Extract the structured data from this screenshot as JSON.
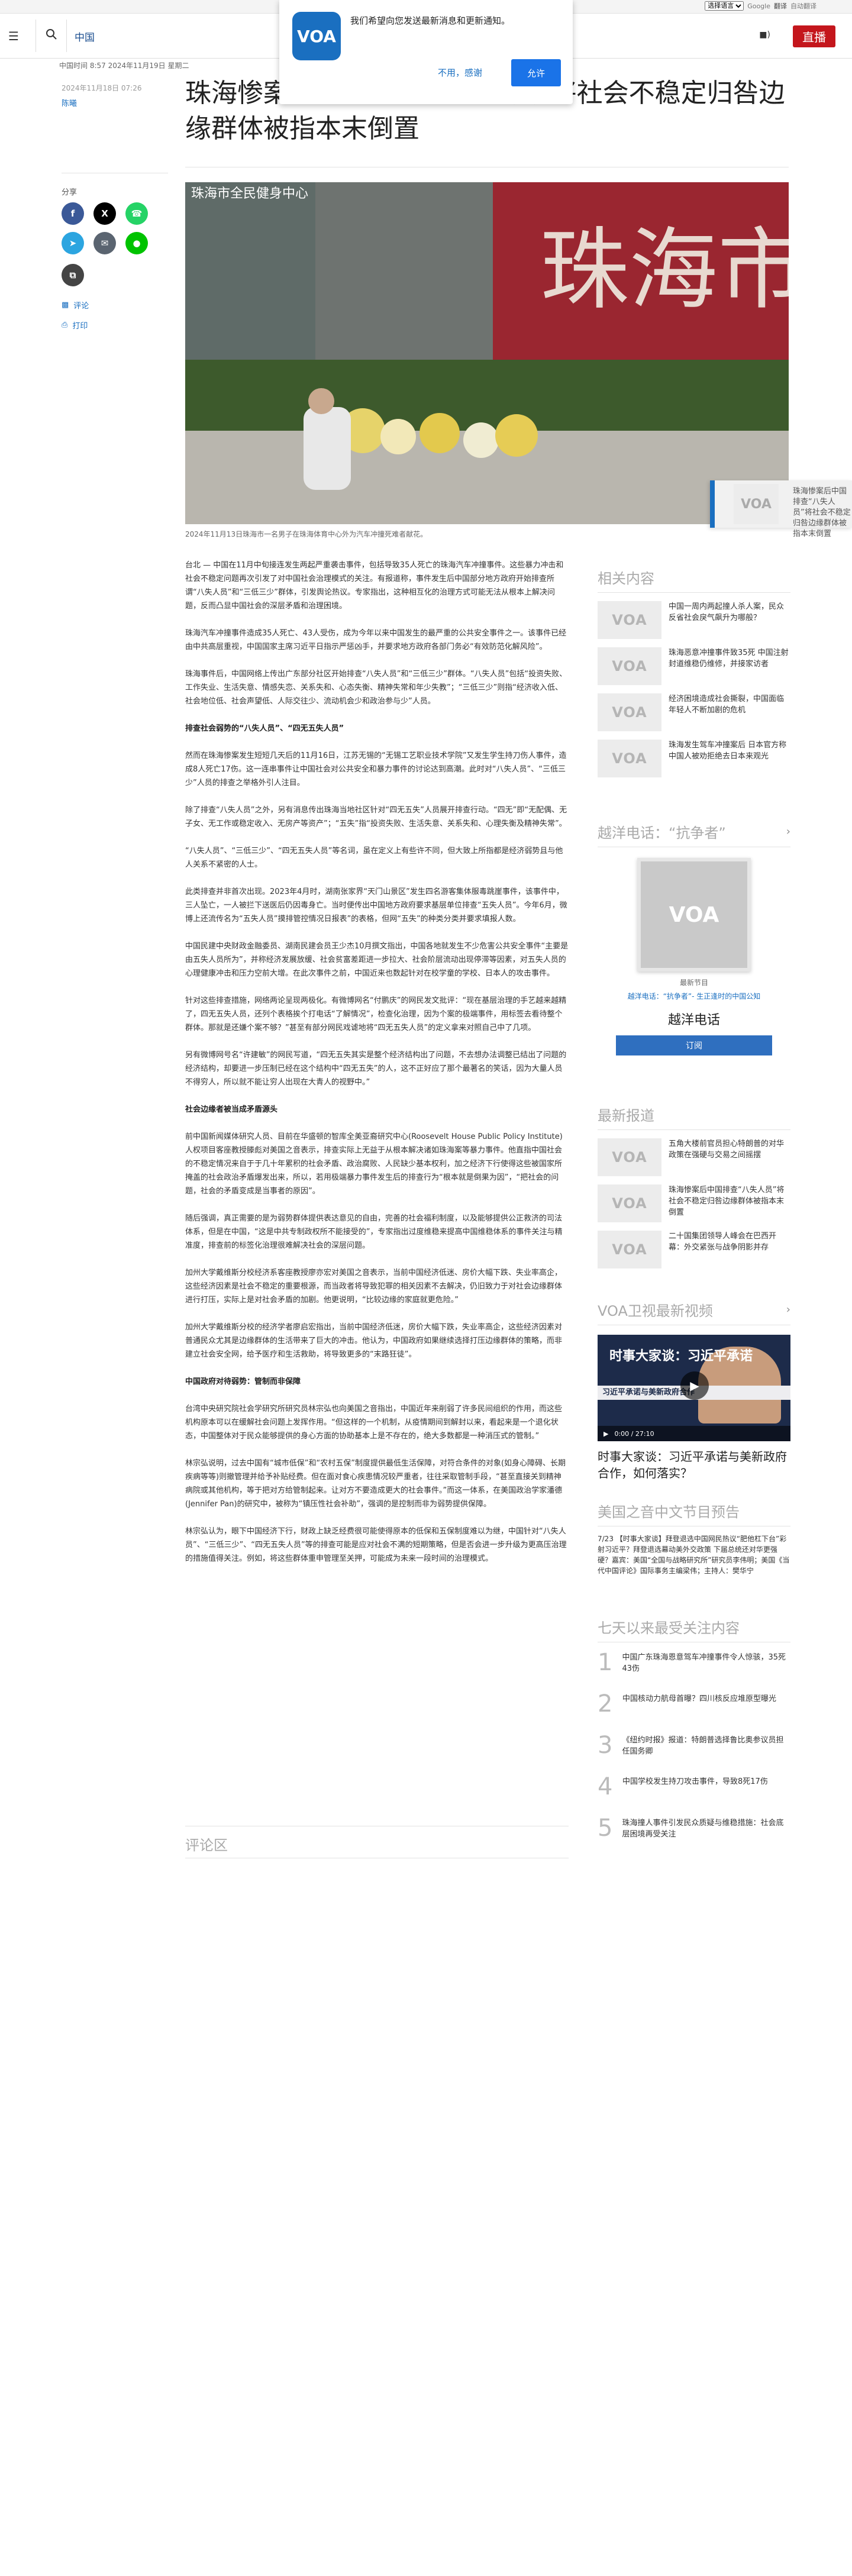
{
  "topbar": {
    "language_select": "选择语言",
    "gt_label": "Google",
    "translate_label": "翻译",
    "translate_suffix": "自动翻译"
  },
  "nav": {
    "section": "中国",
    "live_label": "直播"
  },
  "popup": {
    "logo": "VOA",
    "message": "我们希望向您发送最新消息和更新通知。",
    "decline": "不用，感谢",
    "accept": "允许"
  },
  "article": {
    "datetime": "中国时间 8:57 2024年11月19日 星期二",
    "pubdate": "2024年11月18日 07:26",
    "author": "陈曦",
    "title": "珠海惨案后中国指控“八失人员”将社会不稳定归咎边缘群体被指本末倒置",
    "share_label": "分享",
    "comment_link": "评论",
    "print_link": "打印",
    "caption": "2024年11月13日珠海市一名男子在珠海体育中心外为汽车冲撞死难者献花。",
    "paragraphs": [
      "台北 — 中国在11月中旬接连发生两起严重袭击事件，包括导致35人死亡的珠海汽车冲撞事件。这些暴力冲击和社会不稳定问题再次引发了对中国社会治理模式的关注。有报道称，事件发生后中国部分地方政府开始排查所谓“八失人员”和“三低三少”群体，引发舆论热议。专家指出，这种相互化的治理方式可能无法从根本上解决问题，反而凸显中国社会的深层矛盾和治理困境。",
      "珠海汽车冲撞事件造成35人死亡、43人受伤，成为今年以来中国发生的最严重的公共安全事件之一。该事件已经由中共高层重视，中国国家主席习近平日指示严惩凶手，并要求地方政府各部门务必“有效防范化解风险”。",
      "珠海事件后，中国网络上传出广东部分社区开始排查“八失人员”和“三低三少”群体。“八失人员”包括“投资失败、工作失业、生活失意、情感失恋、关系失和、心态失衡、精神失常和年少失教”；“三低三少”则指“经济收入低、社会地位低、社会声望低、人际交往少、流动机会少和政治参与少”人员。"
    ],
    "h1": "排查社会弱势的“八失人员”、“四无五失人员”",
    "paragraphs2": [
      "然而在珠海惨案发生短短几天后的11月16日，江苏无锡的“无锡工艺职业技术学院”又发生学生持刀伤人事件，造成8人死亡17伤。这一连串事件让中国社会对公共安全和暴力事件的讨论达到高潮。此时对“八失人员”、“三低三少”人员的排查之举格外引人注目。",
      "除了排查“八失人员”之外，另有消息传出珠海当地社区针对“四无五失”人员展开排查行动。“四无”即“无配偶、无子女、无工作或稳定收入、无房产等资产”；“五失”指“投资失败、生活失意、关系失和、心理失衡及精神失常”。",
      "“八失人员”、“三低三少”、“四无五失人员”等名词，虽在定义上有些许不同，但大致上所指都是经济弱势且与他人关系不紧密的人士。",
      "此类排查并非首次出现。2023年4月时，湖南张家界“天门山景区”发生四名游客集体服毒跳崖事件，该事件中，三人坠亡，一人被拦下送医后仍因毒身亡。当时便传出中国地方政府要求基层单位排查“五失人员”。今年6月，微博上还流传名为“五失人员”摸排管控情况日报表”的表格，但网“五失”的种类分类并要求填报人数。",
      "中国民建中央财政金融委员、湖南民建会员王少杰10月撰文指出，中国各地就发生不少危害公共安全事件“主要是由五失人员所为”，并称经济发展放缓、社会贫富差距进一步拉大、社会阶层流动出现停滞等因素，对五失人员的心理健康冲击和压力空前大增。在此次事件之前，中国近来也数起针对在校学童的学校、日本人的攻击事件。",
      "针对这些排查措施，网络两论呈现两极化。有微博网名“付鹏庆”的网民发文批评：“现在基层治理的手艺越来越精了，四无五失人员，还列个表格挨个打电话“了解情况”，检查化治理，因为个案的极端事件，用标签去看待整个群体。那就是还嫌个案不够？”甚至有部分网民戏谑地将“四无五失人员”的定义拿来对照自己中了几项。",
      "另有微博网号名“许建敏”的网民写道，“四无五失其实是整个经济结构出了问题，不去想办法调整已结出了问题的经济结构，却要进一步压制已经在这个结构中“四无五失”的人，这不正好应了那个最著名的笑话，因为大量人员不得穷人，所以就不能让穷人出现在大青人的视野中。”"
    ],
    "h2": "社会边缘者被当成矛盾源头",
    "paragraphs3": [
      "前中国新闻媒体研究人员、目前在华盛顿的智库全美亚裔研究中心(Roosevelt House Public Policy Institute)人权项目客座教授滕彪对美国之音表示，排查实际上无益于从根本解决诸如珠海案等暴力事件。他直指中国社会的不稳定情况来自于于几十年累积的社会矛盾、政治腐败、人民缺少基本权利，加之经济下行使得这些被国家所掩盖的社会政治矛盾爆发出来，所以，若用极端暴力事件发生后的排查行为“根本就是倒果为因”，“把社会的问题，社会的矛盾变成是当事者的原因”。",
      "随后强调，真正需要的是为弱势群体提供表达意见的自由，完善的社会福利制度，以及能够提供公正救济的司法体系，但是在中国，“这是中共专制政权所不能接受的”，专家指出过度维稳来提高中国维稳体系的事件关注与精准度，排查前的标签化治理很难解决社会的深层问题。",
      "加州大学戴维斯分校经济系客座教授廖亦宏对美国之音表示，当前中国经济低迷、房价大幅下跌、失业率高企，这些经济因素是社会不稳定的重要根源，而当政者将导致犯罪的相关因素不去解决，仍旧致力于对社会边缘群体进行打压，实际上是对社会矛盾的加剧。他更说明，“比较边缘的家庭就更危险。”",
      "加州大学戴维斯分校的经济学者廖启宏指出，当前中国经济低迷，房价大幅下跌，失业率高企，这些经济因素对普通民众尤其是边缘群体的生活带来了巨大的冲击。他认为，中国政府如果继续选择打压边缘群体的策略，而非建立社会安全网，给予医疗和生活救助，将导致更多的“末路狂徒”。"
    ],
    "h3": "中国政府对待弱势：管制而非保障",
    "paragraphs4": [
      "台湾中央研究院社会学研究所研究员林宗弘也向美国之音指出，中国近年来削弱了许多民间组织的作用，而这些机构原本可以在缓解社会问题上发挥作用。“但这样的一个机制，从疫情期间到解封以来，看起来是一个退化状态，中国整体对于民众能够提供的身心方面的协助基本上是不存在的，绝大多数都是一种消压式的管制。”",
      "林宗弘说明，过去中国有“城市低保”和“农村五保”制度提供最低生活保障，对符合条件的对象(如身心障碍、长期疾病等等)则撤管理并给予补贴经费。但在面对食心疾患情况较严重者，往往采取管制手段，“甚至直接关到精神病院或其他机构，等于把对方给管制起来。让对方不要造成更大的社会事件。”而这一体系，在美国政治学家潘德(Jennifer Pan)的研究中，被称为“镇压性社会补助”，强调的是控制而非为弱势提供保障。",
      "林宗弘认为，眼下中国经济下行，财政上缺乏经费很可能使得原本的低保和五保制度难以为继，中国针对“八失人员”、“三低三少”、“四无五失人员”等的排查可能是应对社会不满的短期策略，但是否会进一步升级为更高压治理的措施值得关注。例如，将这些群体重申管理至关押，可能成为未来一段时间的治理模式。"
    ]
  },
  "comments_heading": "评论区",
  "related": {
    "heading": "相关内容",
    "items": [
      "中国一周内两起撞人杀人案，民众反省社会戾气飙升为哪般？",
      "珠海恶意冲撞事件致35死 中国注射封道维稳仍维修，并接家访者",
      "经济困境造成社会撕裂，中国面临年轻人不断加剧的危机",
      "珠海发生驾车冲撞案后 日本官方称中国人被劝拒绝去日本来观光"
    ]
  },
  "hotline": {
    "heading": "越洋电话：“抗争者”",
    "cover": "VOA",
    "latest_label": "最新节目",
    "latest_link": "越洋电话：“抗争者”- 生正逢时的中国公知",
    "program_name": "越洋电话",
    "subscribe": "订阅"
  },
  "latest": {
    "heading": "最新报道",
    "items": [
      "五角大楼前官员担心特朗普的对华政策在强硬与交易之间摇摆",
      "珠海惨案后中国排查“八失人员”将社会不稳定归咎边缘群体被指本末倒置",
      "二十国集团领导人峰会在巴西开幕：外交紧张与战争阴影并存"
    ]
  },
  "video": {
    "heading": "VOA卫视最新视频",
    "overlay_title": "时事大家谈：习近平承诺",
    "band": "习近平承诺与美新政府合作",
    "time": "0:00 / 27:10",
    "caption": "时事大家谈：习近平承诺与美新政府合作，如何落实？"
  },
  "program": {
    "heading": "美国之音中文节目预告",
    "text": "7/23 【时事大家谈】拜登退选中国网民热议“肥他杠下台”彩射习近平？拜登退选幕动美外交政策 下届总统还对华更强硬？嘉宾：美国“全国与战略研究所”研究员李伟明；美国《当代中国评论》国际事务主编梁伟；主持人：樊华宁"
  },
  "most_viewed": {
    "heading": "七天以来最受关注内容",
    "items": [
      {
        "rank": "1",
        "text": "中国广东珠海恩意驾车冲撞事件令人惊骇，35死43伤"
      },
      {
        "rank": "2",
        "text": "中国核动力航母首曝？四川核反应堆原型曝光"
      },
      {
        "rank": "3",
        "text": "《纽约时报》报道：特朗普选择鲁比奥参议员担任国务卿"
      },
      {
        "rank": "4",
        "text": "中国学校发生持刀攻击事件，导致8死17伤"
      },
      {
        "rank": "5",
        "text": "珠海撞人事件引发民众质疑与维稳措施：社会底层困境再受关注"
      }
    ]
  },
  "colors": {
    "brand": "#1a6fc0",
    "live": "#c4161c",
    "facebook": "#3b5998",
    "x": "#000000",
    "whatsapp": "#25d366",
    "telegram": "#2ca5e0",
    "email": "#5a6470",
    "line": "#00c300",
    "copy": "#444444"
  },
  "icons": [
    "menu-icon",
    "search-icon",
    "audio-icon",
    "video-icon",
    "comment-icon",
    "print-icon",
    "chevron-right-icon",
    "play-icon"
  ]
}
